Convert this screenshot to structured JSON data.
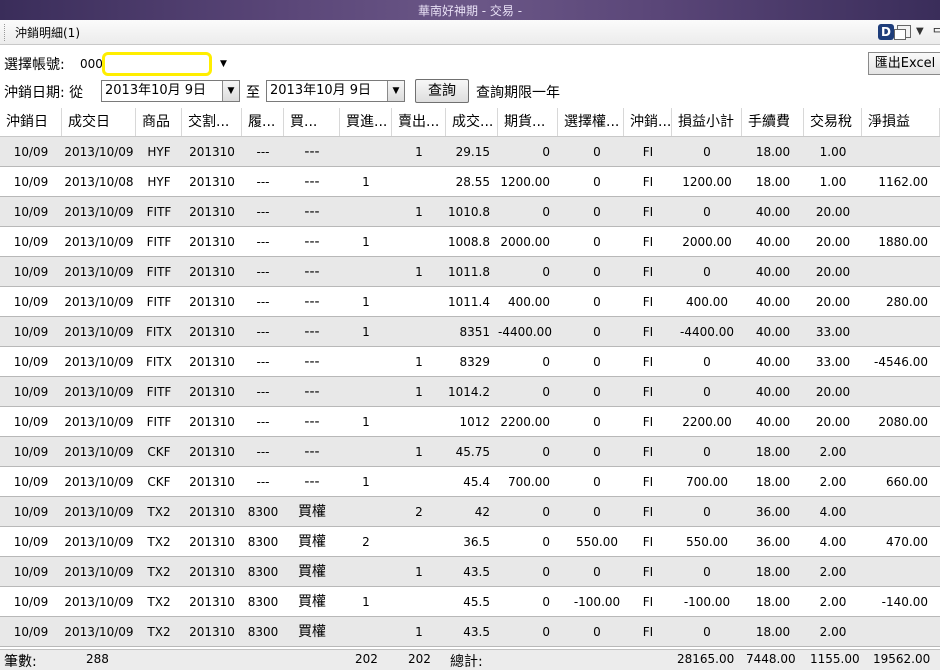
{
  "window": {
    "title": "華南好神期 - 交易 -"
  },
  "tab": {
    "label": "沖銷明細(1)",
    "d_icon": "D"
  },
  "toolbar": {
    "account_label": "選擇帳號:",
    "account_value": "000",
    "date_label": "沖銷日期: 從",
    "from_date": "2013年10月  9日",
    "to_label": "至",
    "to_date": "2013年10月  9日",
    "query_button": "查詢",
    "limit_note": "查詢期限一年",
    "excel_button": "匯出Excel"
  },
  "table": {
    "headers": [
      "沖銷日",
      "成交日",
      "商品",
      "交割...",
      "履...",
      "買...",
      "買進...",
      "賣出...",
      "成交...",
      "期貨...",
      "選擇權...",
      "沖銷...",
      "損益小計",
      "手續費",
      "交易稅",
      "淨損益"
    ],
    "rows": [
      [
        "10/09",
        "2013/10/09",
        "HYF",
        "201310",
        "---",
        "---",
        "",
        "1",
        "29.15",
        "0",
        "0",
        "FI",
        "0",
        "18.00",
        "1.00",
        ""
      ],
      [
        "10/09",
        "2013/10/08",
        "HYF",
        "201310",
        "---",
        "---",
        "1",
        "",
        "28.55",
        "1200.00",
        "0",
        "FI",
        "1200.00",
        "18.00",
        "1.00",
        "1162.00"
      ],
      [
        "10/09",
        "2013/10/09",
        "FITF",
        "201310",
        "---",
        "---",
        "",
        "1",
        "1010.8",
        "0",
        "0",
        "FI",
        "0",
        "40.00",
        "20.00",
        ""
      ],
      [
        "10/09",
        "2013/10/09",
        "FITF",
        "201310",
        "---",
        "---",
        "1",
        "",
        "1008.8",
        "2000.00",
        "0",
        "FI",
        "2000.00",
        "40.00",
        "20.00",
        "1880.00"
      ],
      [
        "10/09",
        "2013/10/09",
        "FITF",
        "201310",
        "---",
        "---",
        "",
        "1",
        "1011.8",
        "0",
        "0",
        "FI",
        "0",
        "40.00",
        "20.00",
        ""
      ],
      [
        "10/09",
        "2013/10/09",
        "FITF",
        "201310",
        "---",
        "---",
        "1",
        "",
        "1011.4",
        "400.00",
        "0",
        "FI",
        "400.00",
        "40.00",
        "20.00",
        "280.00"
      ],
      [
        "10/09",
        "2013/10/09",
        "FITX",
        "201310",
        "---",
        "---",
        "1",
        "",
        "8351",
        "-4400.00",
        "0",
        "FI",
        "-4400.00",
        "40.00",
        "33.00",
        ""
      ],
      [
        "10/09",
        "2013/10/09",
        "FITX",
        "201310",
        "---",
        "---",
        "",
        "1",
        "8329",
        "0",
        "0",
        "FI",
        "0",
        "40.00",
        "33.00",
        "-4546.00"
      ],
      [
        "10/09",
        "2013/10/09",
        "FITF",
        "201310",
        "---",
        "---",
        "",
        "1",
        "1014.2",
        "0",
        "0",
        "FI",
        "0",
        "40.00",
        "20.00",
        ""
      ],
      [
        "10/09",
        "2013/10/09",
        "FITF",
        "201310",
        "---",
        "---",
        "1",
        "",
        "1012",
        "2200.00",
        "0",
        "FI",
        "2200.00",
        "40.00",
        "20.00",
        "2080.00"
      ],
      [
        "10/09",
        "2013/10/09",
        "CKF",
        "201310",
        "---",
        "---",
        "",
        "1",
        "45.75",
        "0",
        "0",
        "FI",
        "0",
        "18.00",
        "2.00",
        ""
      ],
      [
        "10/09",
        "2013/10/09",
        "CKF",
        "201310",
        "---",
        "---",
        "1",
        "",
        "45.4",
        "700.00",
        "0",
        "FI",
        "700.00",
        "18.00",
        "2.00",
        "660.00"
      ],
      [
        "10/09",
        "2013/10/09",
        "TX2",
        "201310",
        "8300",
        "買權",
        "",
        "2",
        "42",
        "0",
        "0",
        "FI",
        "0",
        "36.00",
        "4.00",
        ""
      ],
      [
        "10/09",
        "2013/10/09",
        "TX2",
        "201310",
        "8300",
        "買權",
        "2",
        "",
        "36.5",
        "0",
        "550.00",
        "FI",
        "550.00",
        "36.00",
        "4.00",
        "470.00"
      ],
      [
        "10/09",
        "2013/10/09",
        "TX2",
        "201310",
        "8300",
        "買權",
        "",
        "1",
        "43.5",
        "0",
        "0",
        "FI",
        "0",
        "18.00",
        "2.00",
        ""
      ],
      [
        "10/09",
        "2013/10/09",
        "TX2",
        "201310",
        "8300",
        "買權",
        "1",
        "",
        "45.5",
        "0",
        "-100.00",
        "FI",
        "-100.00",
        "18.00",
        "2.00",
        "-140.00"
      ],
      [
        "10/09",
        "2013/10/09",
        "TX2",
        "201310",
        "8300",
        "買權",
        "",
        "1",
        "43.5",
        "0",
        "0",
        "FI",
        "0",
        "18.00",
        "2.00",
        ""
      ]
    ]
  },
  "footer": {
    "count_label": "筆數:",
    "count": "288",
    "buy_total": "202",
    "sell_total": "202",
    "total_label": "總計:",
    "pnl_total": "28165.00",
    "fee_total": "7448.00",
    "tax_total": "1155.00",
    "net_total": "19562.00"
  }
}
